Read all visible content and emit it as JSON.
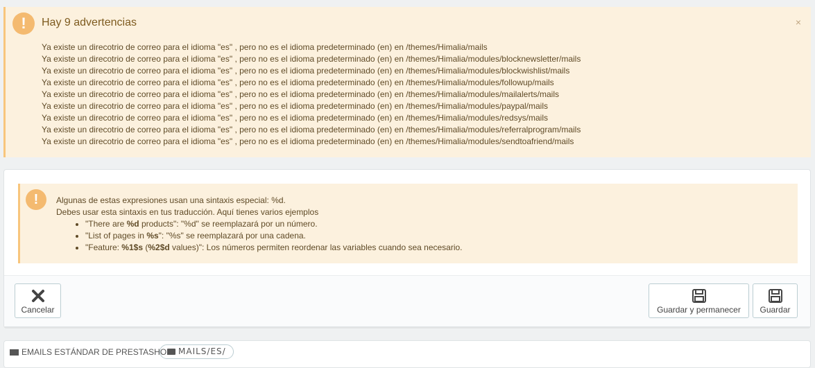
{
  "warning": {
    "title": "Hay 9 advertencias",
    "close": "×",
    "items": [
      "Ya existe un direcotrio de correo para el idioma \"es\" , pero no es el idioma predeterminado (en) en /themes/Himalia/mails",
      "Ya existe un direcotrio de correo para el idioma \"es\" , pero no es el idioma predeterminado (en) en /themes/Himalia/modules/blocknewsletter/mails",
      "Ya existe un direcotrio de correo para el idioma \"es\" , pero no es el idioma predeterminado (en) en /themes/Himalia/modules/blockwishlist/mails",
      "Ya existe un direcotrio de correo para el idioma \"es\" , pero no es el idioma predeterminado (en) en /themes/Himalia/modules/followup/mails",
      "Ya existe un direcotrio de correo para el idioma \"es\" , pero no es el idioma predeterminado (en) en /themes/Himalia/modules/mailalerts/mails",
      "Ya existe un direcotrio de correo para el idioma \"es\" , pero no es el idioma predeterminado (en) en /themes/Himalia/modules/paypal/mails",
      "Ya existe un direcotrio de correo para el idioma \"es\" , pero no es el idioma predeterminado (en) en /themes/Himalia/modules/redsys/mails",
      "Ya existe un direcotrio de correo para el idioma \"es\" , pero no es el idioma predeterminado (en) en /themes/Himalia/modules/referralprogram/mails",
      "Ya existe un direcotrio de correo para el idioma \"es\" , pero no es el idioma predeterminado (en) en /themes/Himalia/modules/sendtoafriend/mails"
    ]
  },
  "info": {
    "line1": "Algunas de estas expresiones usan una sintaxis especial: %d.",
    "line2": "Debes usar esta sintaxis en tus traducción. Aquí tienes varios ejemplos",
    "ex1_a": "\"There are ",
    "ex1_b": "%d",
    "ex1_c": " products\": \"%d\" se reemplazará por un número.",
    "ex2_a": "\"List of pages in ",
    "ex2_b": "%s",
    "ex2_c": "\": \"%s\" se reemplazará por una cadena.",
    "ex3_a": "\"Feature: ",
    "ex3_b": "%1$s",
    "ex3_c": " (",
    "ex3_d": "%2$d",
    "ex3_e": " values)\": Los números permiten reordenar las variables cuando sea necesario."
  },
  "buttons": {
    "cancel": "Cancelar",
    "save_stay": "Guardar y permanecer",
    "save": "Guardar"
  },
  "section": {
    "title": "Emails estándar de PrestaShop",
    "path": "MAILS/ES/"
  }
}
